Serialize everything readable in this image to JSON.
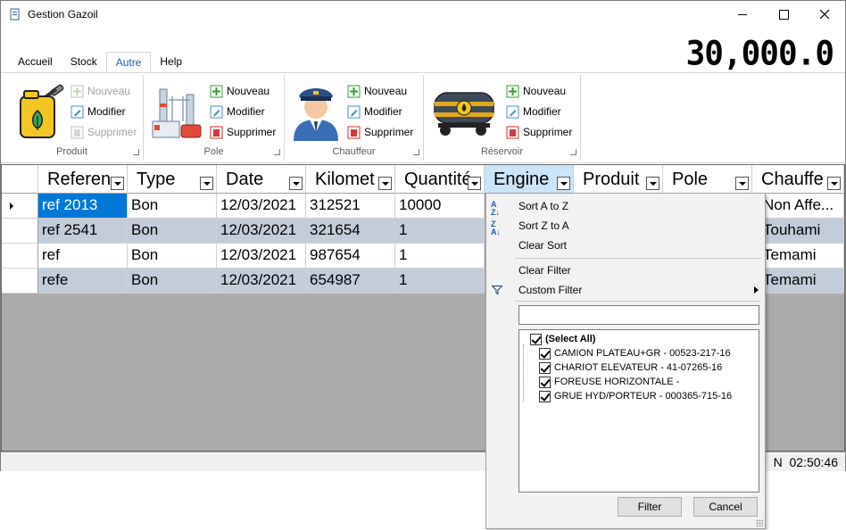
{
  "window": {
    "title": "Gestion Gazoil"
  },
  "counter": "30,000.0",
  "tabs": [
    {
      "label": "Accueil"
    },
    {
      "label": "Stock"
    },
    {
      "label": "Autre"
    },
    {
      "label": "Help"
    }
  ],
  "ribbon": {
    "groups": [
      {
        "label": "Produit",
        "nouveau": "Nouveau",
        "modifier": "Modifier",
        "supprimer": "Supprimer"
      },
      {
        "label": "Pole",
        "nouveau": "Nouveau",
        "modifier": "Modifier",
        "supprimer": "Supprimer"
      },
      {
        "label": "Chauffeur",
        "nouveau": "Nouveau",
        "modifier": "Modifier",
        "supprimer": "Supprimer"
      },
      {
        "label": "Réservoir",
        "nouveau": "Nouveau",
        "modifier": "Modifier",
        "supprimer": "Supprimer"
      }
    ]
  },
  "grid": {
    "columns": [
      "Referen",
      "Type",
      "Date",
      "Kilomet",
      "Quantité",
      "Engine",
      "Produit",
      "Pole",
      "Chauffe"
    ],
    "rows": [
      [
        "ref 2013",
        "Bon",
        "12/03/2021",
        "312521",
        "10000",
        "Non Affe..."
      ],
      [
        "ref 2541",
        "Bon",
        "12/03/2021",
        "321654",
        "1",
        "Touhami"
      ],
      [
        "ref",
        "Bon",
        "12/03/2021",
        "987654",
        "1",
        "Temami"
      ],
      [
        "refe",
        "Bon",
        "12/03/2021",
        "654987",
        "1",
        "Temami"
      ]
    ]
  },
  "status": {
    "clock_prefix": "N",
    "clock": "02:50:46"
  },
  "filter_menu": {
    "sort_az": "Sort A to Z",
    "sort_za": "Sort Z to A",
    "clear_sort": "Clear Sort",
    "clear_filter": "Clear Filter",
    "custom_filter": "Custom Filter",
    "search_value": "",
    "items": [
      {
        "label": "(Select All)",
        "checked": true
      },
      {
        "label": "CAMION PLATEAU+GR  -  00523-217-16",
        "checked": true
      },
      {
        "label": "CHARIOT ELEVATEUR  -  41-07265-16",
        "checked": true
      },
      {
        "label": "FOREUSE HORIZONTALE  -",
        "checked": true
      },
      {
        "label": "GRUE HYD/PORTEUR  -  000365-715-16",
        "checked": true
      }
    ],
    "filter_button": "Filter",
    "cancel_button": "Cancel"
  }
}
